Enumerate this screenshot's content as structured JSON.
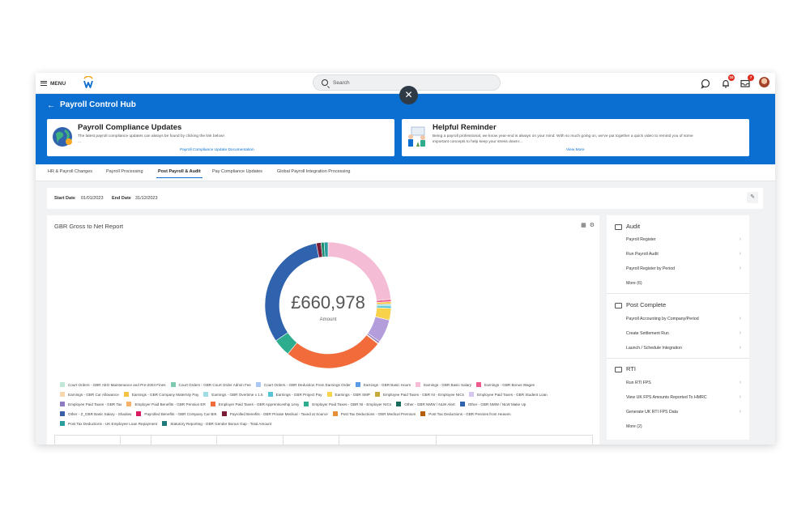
{
  "topbar": {
    "menu_label": "MENU",
    "search_placeholder": "Search",
    "notifications_count": "10",
    "inbox_count": "7"
  },
  "hub": {
    "title": "Payroll Control Hub",
    "cards": [
      {
        "title": "Payroll Compliance Updates",
        "text": "The latest payroll compliance updates can always be found by clicking the link below!",
        "text2": "...",
        "link": "Payroll Compliance Update Documentation"
      },
      {
        "title": "Helpful Reminder",
        "text": "Being a payroll professional, we know year-end is always on your mind. With so much going on, we've put together a quick video to remind you of some",
        "text2": "important concepts to help keep your stress down!...",
        "link": "View More"
      }
    ]
  },
  "tabs": [
    {
      "label": "HR & Payroll Changes",
      "active": false
    },
    {
      "label": "Payroll Processing",
      "active": false
    },
    {
      "label": "Post Payroll & Audit",
      "active": true
    },
    {
      "label": "Pay Compliance Updates",
      "active": false
    },
    {
      "label": "Global Payroll Integration Processing",
      "active": false
    }
  ],
  "dates": {
    "start_label": "Start Date",
    "start_value": "01/01/2023",
    "end_label": "End Date",
    "end_value": "31/12/2023"
  },
  "report": {
    "title": "GBR Gross to Net Report",
    "center_value": "£660,978",
    "center_label": "Amount"
  },
  "chart_data": {
    "type": "pie",
    "center_value": "£660,978",
    "center_label": "Amount",
    "slices": [
      {
        "name": "Earnings - GBR Basic Salary",
        "share": 0.235,
        "color": "#f5bcd6"
      },
      {
        "name": "Earnings - GBR Bonus Wages",
        "share": 0.006,
        "color": "#ef5b8c"
      },
      {
        "name": "Earnings - GBR Company Maternity Pay",
        "share": 0.006,
        "color": "#f6c244"
      },
      {
        "name": "Earnings - GBR Overtime x 1.5",
        "share": 0.005,
        "color": "#9fdde6"
      },
      {
        "name": "Earnings - GBR Project Pay",
        "share": 0.006,
        "color": "#56c3d2"
      },
      {
        "name": "Earnings - GBR SMP",
        "share": 0.03,
        "color": "#f8d24a"
      },
      {
        "name": "Employee Paid Taxes - GBR Student Loan",
        "share": 0.06,
        "color": "#b39ddb"
      },
      {
        "name": "Employee Paid Taxes - GBR Tax",
        "share": 0.005,
        "color": "#8e7cc3"
      },
      {
        "name": "Employer Paid Benefits - GBR Pension ER",
        "share": 0.002,
        "color": "#f6b26b"
      },
      {
        "name": "Employer Paid Taxes - GBR NI - Employer NICs",
        "share": 0.255,
        "color": "#f26b3a"
      },
      {
        "name": "Other - GBR NMW / NLW Alert",
        "share": 0.045,
        "color": "#2ead8e"
      },
      {
        "name": "Other - GBR NMW / NLW Make Up",
        "share": 0.315,
        "color": "#2f63ad"
      },
      {
        "name": "Payrolled Benefits - GBR Private Medical - Taxed at Source",
        "share": 0.012,
        "color": "#7b1c36"
      },
      {
        "name": "Post Tax Deductions - GBR Medical Premium",
        "share": 0.008,
        "color": "#1a8e6e"
      },
      {
        "name": "Post Tax Deductions - UK Employee Loan Repayment",
        "share": 0.01,
        "color": "#2a9d9d"
      }
    ],
    "legend": [
      {
        "label": "Court Orders - GBR AEO Maintenance and Pre-2004 Fines",
        "color": "#bfe6d6"
      },
      {
        "label": "Court Orders - GBR Court Order Admin Fee",
        "color": "#7fcbb0"
      },
      {
        "label": "Court Orders - GBR Deduction From Earnings Order",
        "color": "#a9c7f0"
      },
      {
        "label": "Earnings - GBR Basic Hours",
        "color": "#5b9be6"
      },
      {
        "label": "Earnings - GBR Basic Salary",
        "color": "#f5bcd6"
      },
      {
        "label": "Earnings - GBR Bonus Wages",
        "color": "#ef5b8c"
      },
      {
        "label": "Earnings - GBR Car Allowance",
        "color": "#f7d7b0"
      },
      {
        "label": "Earnings - GBR Company Maternity Pay",
        "color": "#f6c244"
      },
      {
        "label": "Earnings - GBR Overtime x 1.5",
        "color": "#9fdde6"
      },
      {
        "label": "Earnings - GBR Project Pay",
        "color": "#56c3d2"
      },
      {
        "label": "Earnings - GBR SMP",
        "color": "#f8d24a"
      },
      {
        "label": "Employee Paid Taxes - GBR NI - Employee NICs",
        "color": "#c6a93a"
      },
      {
        "label": "Employee Paid Taxes - GBR Student Loan",
        "color": "#d7c7f0"
      },
      {
        "label": "Employee Paid Taxes - GBR Tax",
        "color": "#8e7cc3"
      },
      {
        "label": "Employer Paid Benefits - GBR Pension ER",
        "color": "#f6b26b"
      },
      {
        "label": "Employer Paid Taxes - GBR Apprenticeship Levy",
        "color": "#f26b3a"
      },
      {
        "label": "Employer Paid Taxes - GBR NI - Employer NICs",
        "color": "#2ead8e"
      },
      {
        "label": "Other - GBR NMW / NLW Alert",
        "color": "#1b6b5a"
      },
      {
        "label": "Other - GBR NMW / NLW Make Up",
        "color": "#2f63ad"
      },
      {
        "label": "Other - Z_GBR Basic Salary - Shadow",
        "color": "#3a5fa8"
      },
      {
        "label": "Payrolled Benefits - GBR Company Car BIK",
        "color": "#d81b60"
      },
      {
        "label": "Payrolled Benefits - GBR Private Medical - Taxed at Source",
        "color": "#7b1c36"
      },
      {
        "label": "Post Tax Deductions - GBR Medical Premium",
        "color": "#e69138"
      },
      {
        "label": "Post Tax Deductions - GBR Pennies from Heaven",
        "color": "#b45f06"
      },
      {
        "label": "Post Tax Deductions - UK Employee Loan Repayment",
        "color": "#2a9d9d"
      },
      {
        "label": "Statutory Reporting - GBR Gender Bonus Gap - Total Amount",
        "color": "#1f7a7a"
      }
    ]
  },
  "side": {
    "sections": [
      {
        "title": "Audit",
        "items": [
          "Payroll Register",
          "Run Payroll Audit",
          "Payroll Register by Period"
        ],
        "more": "More (6)"
      },
      {
        "title": "Post Complete",
        "items": [
          "Payroll Accounting by Company/Period",
          "Create Settlement Run",
          "Launch / Schedule Integration"
        ],
        "more": ""
      },
      {
        "title": "RTI",
        "items": [
          "Run RTI FPS",
          "View UK FPS Amounts Reported To HMRC",
          "Generate UK RTI FPS Data"
        ],
        "more": "More (2)"
      }
    ]
  }
}
